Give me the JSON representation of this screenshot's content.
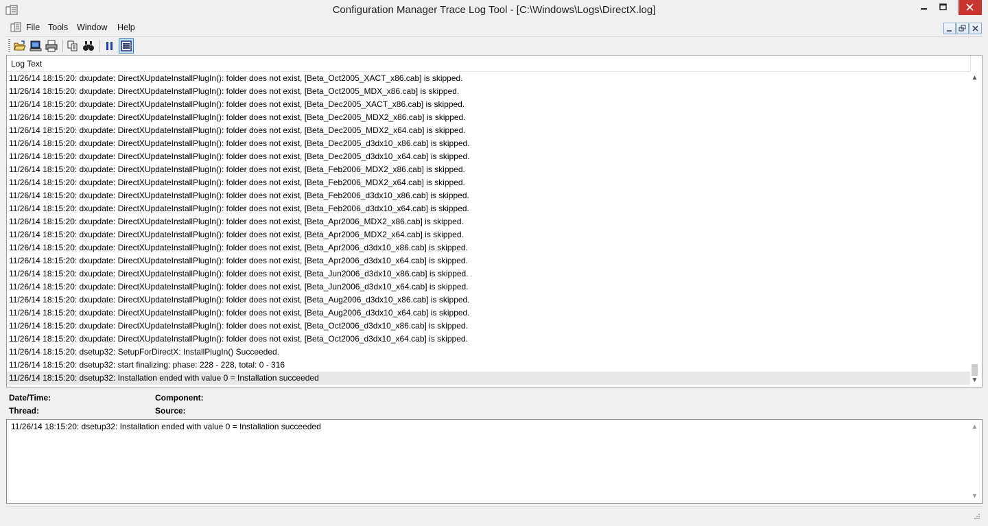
{
  "window": {
    "title": "Configuration Manager Trace Log Tool - [C:\\Windows\\Logs\\DirectX.log]",
    "icon": "app-icon",
    "controls": [
      "minimize-icon",
      "maximize-icon",
      "close-icon"
    ]
  },
  "menu": {
    "items": [
      "File",
      "Tools",
      "Window",
      "Help"
    ]
  },
  "toolbar": {
    "buttons": [
      "open-folder-icon",
      "open-on-server-icon",
      "print-icon",
      "copy-icon",
      "find-icon",
      "pause-icon",
      "highlight-icon"
    ]
  },
  "log": {
    "column_header": "Log Text",
    "rows": [
      "11/26/14 18:15:20: dxupdate: DirectXUpdateInstallPlugIn(): folder does not exist, [Beta_Oct2005_XACT_x86.cab] is skipped.",
      "11/26/14 18:15:20: dxupdate: DirectXUpdateInstallPlugIn(): folder does not exist, [Beta_Oct2005_MDX_x86.cab] is skipped.",
      "11/26/14 18:15:20: dxupdate: DirectXUpdateInstallPlugIn(): folder does not exist, [Beta_Dec2005_XACT_x86.cab] is skipped.",
      "11/26/14 18:15:20: dxupdate: DirectXUpdateInstallPlugIn(): folder does not exist, [Beta_Dec2005_MDX2_x86.cab] is skipped.",
      "11/26/14 18:15:20: dxupdate: DirectXUpdateInstallPlugIn(): folder does not exist, [Beta_Dec2005_MDX2_x64.cab] is skipped.",
      "11/26/14 18:15:20: dxupdate: DirectXUpdateInstallPlugIn(): folder does not exist, [Beta_Dec2005_d3dx10_x86.cab] is skipped.",
      "11/26/14 18:15:20: dxupdate: DirectXUpdateInstallPlugIn(): folder does not exist, [Beta_Dec2005_d3dx10_x64.cab] is skipped.",
      "11/26/14 18:15:20: dxupdate: DirectXUpdateInstallPlugIn(): folder does not exist, [Beta_Feb2006_MDX2_x86.cab] is skipped.",
      "11/26/14 18:15:20: dxupdate: DirectXUpdateInstallPlugIn(): folder does not exist, [Beta_Feb2006_MDX2_x64.cab] is skipped.",
      "11/26/14 18:15:20: dxupdate: DirectXUpdateInstallPlugIn(): folder does not exist, [Beta_Feb2006_d3dx10_x86.cab] is skipped.",
      "11/26/14 18:15:20: dxupdate: DirectXUpdateInstallPlugIn(): folder does not exist, [Beta_Feb2006_d3dx10_x64.cab] is skipped.",
      "11/26/14 18:15:20: dxupdate: DirectXUpdateInstallPlugIn(): folder does not exist, [Beta_Apr2006_MDX2_x86.cab] is skipped.",
      "11/26/14 18:15:20: dxupdate: DirectXUpdateInstallPlugIn(): folder does not exist, [Beta_Apr2006_MDX2_x64.cab] is skipped.",
      "11/26/14 18:15:20: dxupdate: DirectXUpdateInstallPlugIn(): folder does not exist, [Beta_Apr2006_d3dx10_x86.cab] is skipped.",
      "11/26/14 18:15:20: dxupdate: DirectXUpdateInstallPlugIn(): folder does not exist, [Beta_Apr2006_d3dx10_x64.cab] is skipped.",
      "11/26/14 18:15:20: dxupdate: DirectXUpdateInstallPlugIn(): folder does not exist, [Beta_Jun2006_d3dx10_x86.cab] is skipped.",
      "11/26/14 18:15:20: dxupdate: DirectXUpdateInstallPlugIn(): folder does not exist, [Beta_Jun2006_d3dx10_x64.cab] is skipped.",
      "11/26/14 18:15:20: dxupdate: DirectXUpdateInstallPlugIn(): folder does not exist, [Beta_Aug2006_d3dx10_x86.cab] is skipped.",
      "11/26/14 18:15:20: dxupdate: DirectXUpdateInstallPlugIn(): folder does not exist, [Beta_Aug2006_d3dx10_x64.cab] is skipped.",
      "11/26/14 18:15:20: dxupdate: DirectXUpdateInstallPlugIn(): folder does not exist, [Beta_Oct2006_d3dx10_x86.cab] is skipped.",
      "11/26/14 18:15:20: dxupdate: DirectXUpdateInstallPlugIn(): folder does not exist, [Beta_Oct2006_d3dx10_x64.cab] is skipped.",
      "11/26/14 18:15:20: dsetup32: SetupForDirectX: InstallPlugIn() Succeeded.",
      "11/26/14 18:15:20: dsetup32: start finalizing: phase: 228 - 228, total: 0 - 316",
      "11/26/14 18:15:20: dsetup32: Installation ended with value 0 = Installation succeeded"
    ],
    "selected_index": 23
  },
  "details": {
    "datetime_label": "Date/Time:",
    "datetime_value": "",
    "component_label": "Component:",
    "component_value": "",
    "thread_label": "Thread:",
    "thread_value": "",
    "source_label": "Source:",
    "source_value": ""
  },
  "message": {
    "text": "11/26/14 18:15:20: dsetup32: Installation ended with value 0 = Installation succeeded"
  }
}
